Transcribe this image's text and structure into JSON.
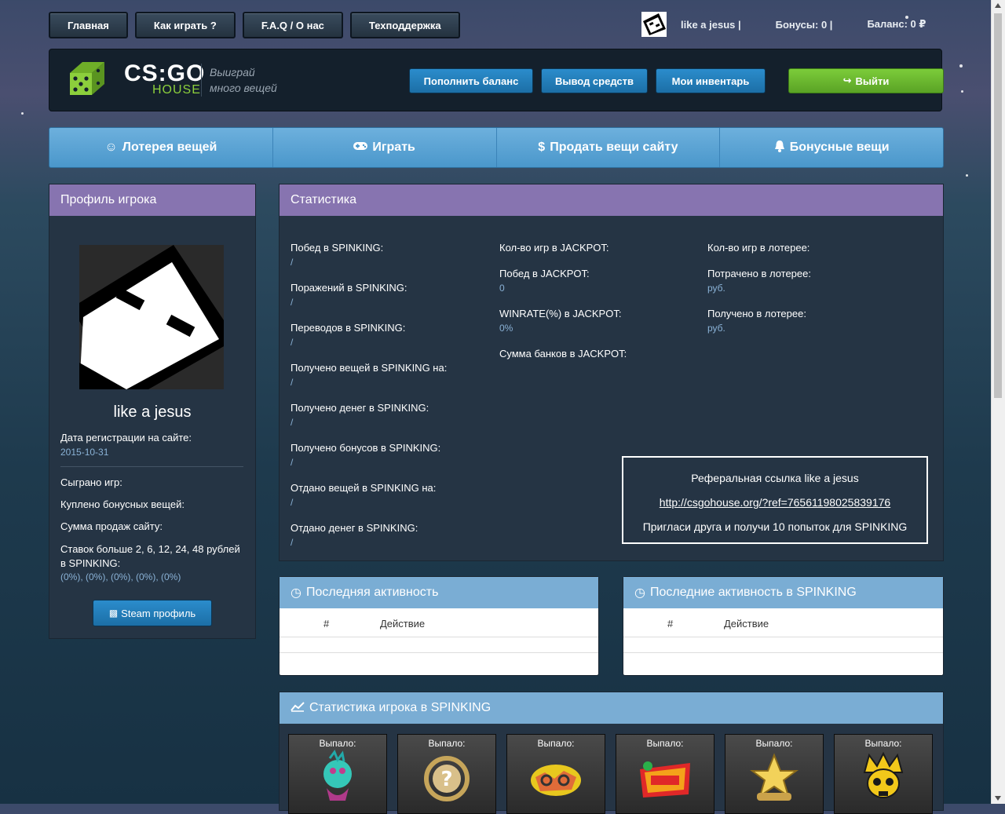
{
  "nav": {
    "items": [
      {
        "label": "Главная"
      },
      {
        "label": "Как играть  ?"
      },
      {
        "label": "F.A.Q / О нас"
      },
      {
        "label": "Техподдержка"
      }
    ]
  },
  "user": {
    "name_label": "like a jesus |",
    "bonus_label": "Бонусы: 0 |",
    "balance_label": "Баланс: 0 ₽"
  },
  "header": {
    "logo_main": "CS:GO",
    "logo_sub": "HOUSE",
    "tagline_1": "Выиграй",
    "tagline_2": "много вещей",
    "buttons": {
      "deposit": "Пополнить баланс",
      "withdraw": "Вывод средств",
      "inventory": "Мои инвентарь",
      "logout": "Выйти"
    }
  },
  "tabs": [
    {
      "label": "Лотерея вещей",
      "icon": "smile-icon"
    },
    {
      "label": "Играть",
      "icon": "gamepad-icon"
    },
    {
      "label": "Продать вещи сайту",
      "icon": "dollar-icon"
    },
    {
      "label": "Бонусные вещи",
      "icon": "bell-icon"
    }
  ],
  "profile": {
    "title": "Профиль игрока",
    "name": "like a jesus",
    "reg_label": "Дата регистрации на сайте:",
    "reg_value": "2015-10-31",
    "games_label": "Сыграно игр:",
    "bonus_items_label": "Куплено бонусных вещей:",
    "sales_label": "Сумма продаж сайту:",
    "bets_label": "Ставок больше 2, 6, 12, 24, 48 рублей в SPINKING:",
    "bets_value": "(0%), (0%), (0%), (0%), (0%)",
    "steam_button": "Steam профиль"
  },
  "stats": {
    "title": "Статистика",
    "col1": [
      {
        "label": "Побед в SPINKING:",
        "value": "/"
      },
      {
        "label": "Поражений в SPINKING:",
        "value": "/"
      },
      {
        "label": "Переводов в SPINKING:",
        "value": "/"
      },
      {
        "label": "Получено вещей в SPINKING на:",
        "value": "/"
      },
      {
        "label": "Получено денег в SPINKING:",
        "value": "/"
      },
      {
        "label": "Получено бонусов в SPINKING:",
        "value": "/"
      },
      {
        "label": "Отдано вещей в SPINKING на:",
        "value": "/"
      },
      {
        "label": "Отдано денег в SPINKING:",
        "value": "/"
      }
    ],
    "col2": [
      {
        "label": "Кол-во игр в JACKPOT:",
        "value": ""
      },
      {
        "label": "Побед в JACKPOT:",
        "value": "0"
      },
      {
        "label": "WINRATE(%) в JACKPOT:",
        "value": "0%"
      },
      {
        "label": "Сумма банков в JACKPOT:",
        "value": ""
      }
    ],
    "col3": [
      {
        "label": "Кол-во игр в лотерее:",
        "value": ""
      },
      {
        "label": "Потрачено в лотерее:",
        "value": "руб."
      },
      {
        "label": "Получено в лотерее:",
        "value": "руб."
      }
    ],
    "referral": {
      "title": "Реферальная ссылка like a jesus",
      "link": "http://csgohouse.org/?ref=76561198025839176",
      "invite": "Пригласи друга и получи 10 попыток для SPINKING"
    }
  },
  "activity": {
    "left_title": "Последняя активность",
    "right_title": "Последние активность в SPINKING",
    "col_num": "#",
    "col_action": "Действие"
  },
  "spinking": {
    "title": "Статистика игрока в SPINKING",
    "cards": [
      {
        "label": "Выпало:",
        "icon": "zombie-sticker-icon"
      },
      {
        "label": "Выпало:",
        "icon": "question-laurel-icon"
      },
      {
        "label": "Выпало:",
        "icon": "back-sticker-icon"
      },
      {
        "label": "Выпало:",
        "icon": "bash-sticker-icon"
      },
      {
        "label": "Выпало:",
        "icon": "return-star-icon"
      },
      {
        "label": "Выпало:",
        "icon": "crown-skull-icon"
      }
    ]
  },
  "colors": {
    "accent_blue": "#2b8ccc",
    "accent_green": "#6bbb2f",
    "header_purple": "#8774b0",
    "header_lightblue": "#7aadd4",
    "stat_value": "#8ab2d6"
  }
}
